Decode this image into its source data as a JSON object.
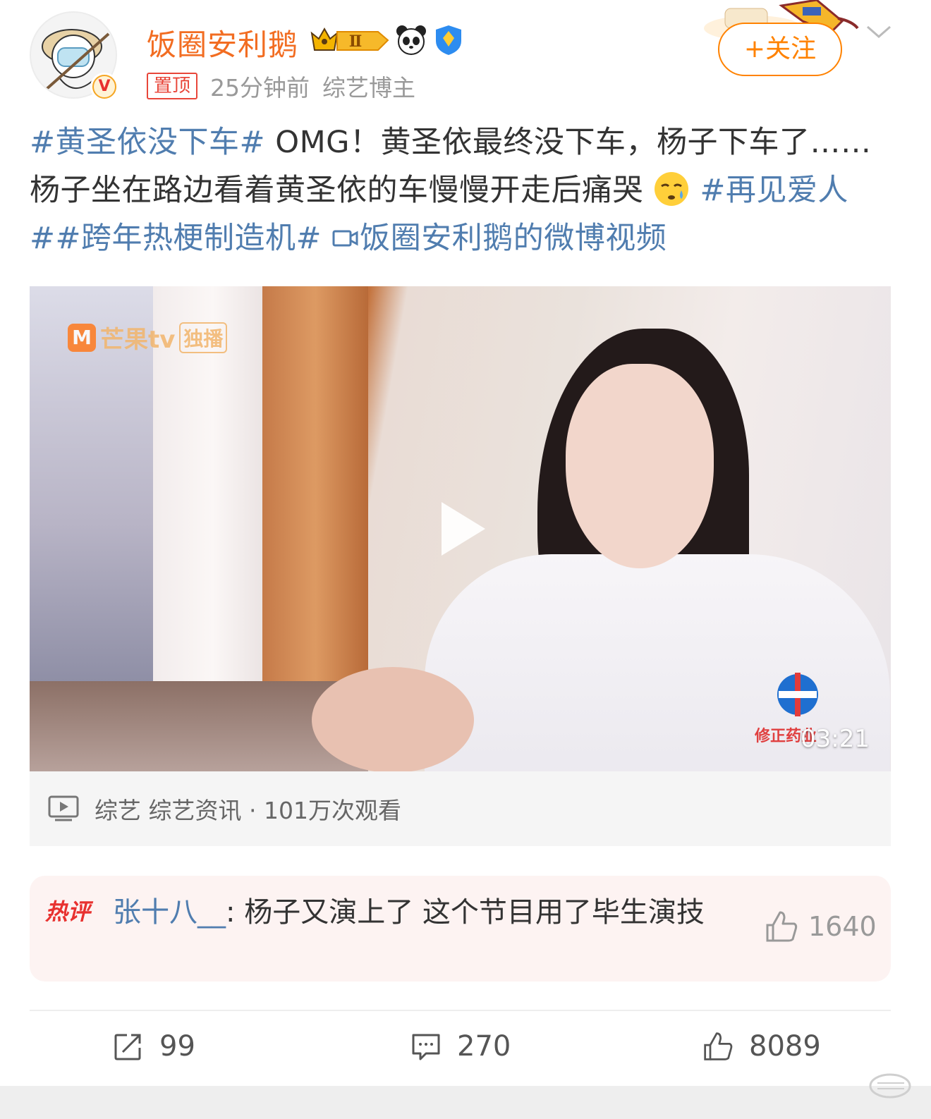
{
  "header": {
    "username": "饭圈安利鹅",
    "level_badge": "Ⅱ",
    "pinned_label": "置顶",
    "timestamp": "25分钟前",
    "user_tag": "综艺博主",
    "follow_label": "+关注",
    "verified_mark": "V"
  },
  "post": {
    "hashtag_1": "#黄圣依没下车#",
    "text_1": " OMG！黄圣依最终没下车，杨子下车了……杨子坐在路边看着黄圣依的车慢慢开走后痛哭",
    "hashtag_2": " #再见爱人#",
    "hashtag_3": "#跨年热梗制造机#",
    "video_link": "饭圈安利鹅的微博视频"
  },
  "video": {
    "logo_text": "芒果tv",
    "logo_tag": "独播",
    "watermark_text": "修正药业",
    "duration": "03:21",
    "info": "综艺 综艺资讯 · 101万次观看"
  },
  "hot_comment": {
    "tag": "热评",
    "user": "张十八__",
    "text": ": 杨子又演上了 这个节目用了毕生演技",
    "likes": "1640"
  },
  "actions": {
    "reposts": "99",
    "comments": "270",
    "likes": "8089"
  },
  "colors": {
    "brand_orange": "#ff8200",
    "username_orange": "#f26d22",
    "link_blue": "#507daf",
    "pin_red": "#e8463a"
  },
  "icons": [
    "chevron-down-icon",
    "crown-badge-icon",
    "panda-icon",
    "shield-icon",
    "play-icon",
    "video-icon",
    "thumbs-up-icon",
    "repost-icon",
    "comment-icon",
    "emoji-icon"
  ]
}
